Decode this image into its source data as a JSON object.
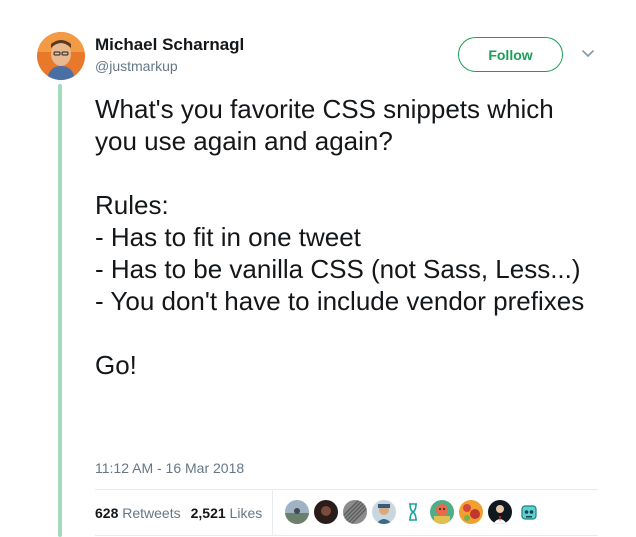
{
  "author": {
    "display_name": "Michael Scharnagl",
    "handle": "@justmarkup"
  },
  "actions": {
    "follow_label": "Follow"
  },
  "tweet": {
    "text": "What's you favorite CSS snippets which you use again and again?\n\nRules:\n- Has to fit in one tweet\n- Has to be vanilla CSS (not Sass, Less...)\n- You don't have to include vendor prefixes\n\nGo!",
    "timestamp": "11:12 AM - 16 Mar 2018"
  },
  "stats": {
    "retweets_count": "628",
    "retweets_label": "Retweets",
    "likes_count": "2,521",
    "likes_label": "Likes"
  },
  "colors": {
    "accent": "#1b9e55",
    "thread_line": "#a3dbbb",
    "muted": "#657786",
    "text": "#14171a"
  },
  "liker_avatars": [
    "sky-landscape-avatar",
    "dark-portrait-avatar",
    "gray-pattern-avatar",
    "person-cap-avatar",
    "hourglass-icon-avatar",
    "colorful-person-avatar",
    "orange-floral-avatar",
    "suit-person-avatar",
    "teal-robot-avatar"
  ]
}
